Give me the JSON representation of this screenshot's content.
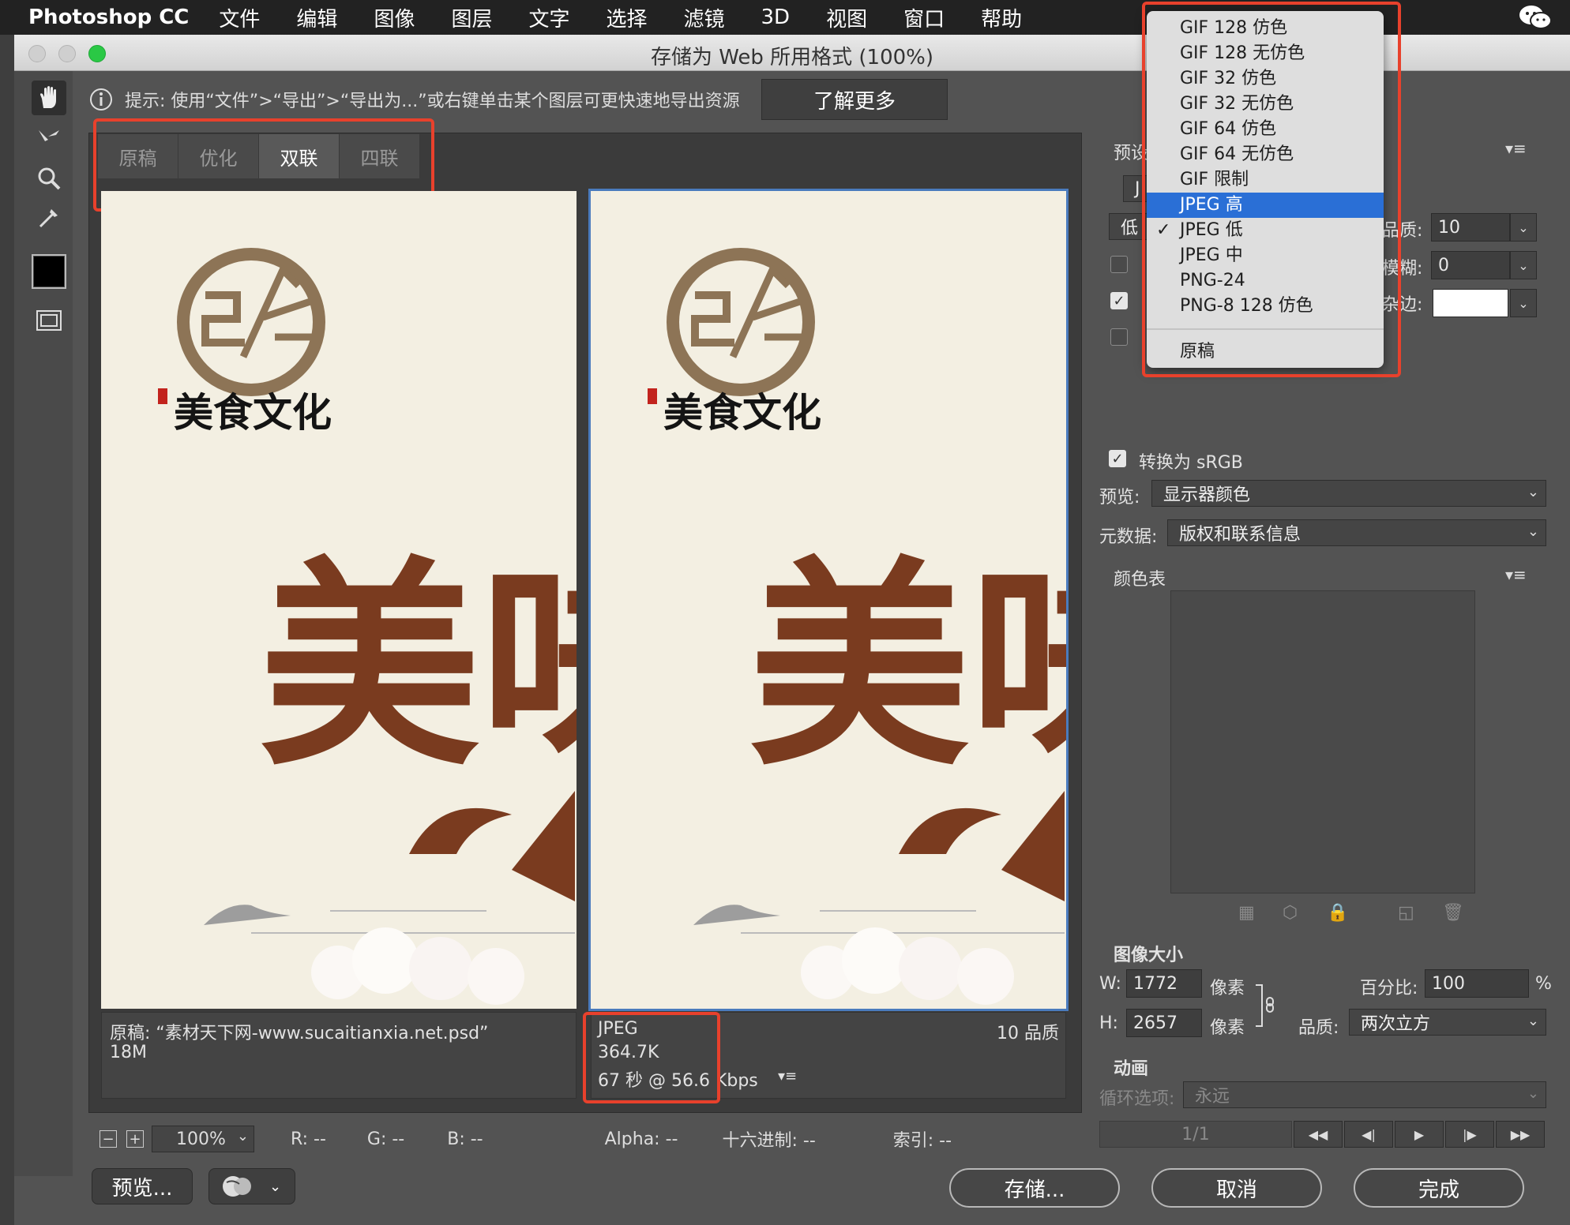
{
  "menubar": {
    "app_name": "Photoshop CC",
    "items": [
      "文件",
      "编辑",
      "图像",
      "图层",
      "文字",
      "选择",
      "滤镜",
      "3D",
      "视图",
      "窗口",
      "帮助"
    ]
  },
  "window": {
    "title": "存储为 Web 所用格式 (100%)"
  },
  "hint": {
    "text": "提示: 使用“文件”>“导出”>“导出为...”或右键单击某个图层可更快速地导出资源",
    "learn_more": "了解更多"
  },
  "tabs": [
    {
      "label": "原稿",
      "active": false
    },
    {
      "label": "优化",
      "active": false
    },
    {
      "label": "双联",
      "active": true
    },
    {
      "label": "四联",
      "active": false
    }
  ],
  "artwork": {
    "brand": "美食文化",
    "headline": "美味"
  },
  "left_pane": {
    "line1": "原稿: “素材天下网-www.sucaitianxia.net.psd”",
    "line2": "18M"
  },
  "right_pane": {
    "format": "JPEG",
    "size": "364.7K",
    "time": "67 秒 @ 56.6 Kbps",
    "quality": "10 品质"
  },
  "statusbar": {
    "zoom": "100%",
    "r": "R: --",
    "g": "G: --",
    "b": "B: --",
    "alpha": "Alpha: --",
    "hex": "十六进制: --",
    "index": "索引: --"
  },
  "buttons": {
    "preview": "预览...",
    "save": "存储...",
    "cancel": "取消",
    "done": "完成"
  },
  "preset_dropdown": {
    "options": [
      "GIF 128 仿色",
      "GIF 128 无仿色",
      "GIF 32 仿色",
      "GIF 32 无仿色",
      "GIF 64 仿色",
      "GIF 64 无仿色",
      "GIF 限制",
      "JPEG 高",
      "JPEG 低",
      "JPEG 中",
      "PNG-24",
      "PNG-8 128 仿色"
    ],
    "highlighted": "JPEG 高",
    "checked": "JPEG 低",
    "extra_option": "原稿"
  },
  "settings": {
    "preset_label_partial": "预设",
    "format_partial": "J",
    "quality_level_partial": "低",
    "quality_label": "品质:",
    "quality_value": "10",
    "blur_label": "模糊:",
    "blur_value": "0",
    "matte_label": "杂边:",
    "matte_color": "#ffffff",
    "checkbox_partial": "✓",
    "convert_srgb_checked": true,
    "convert_srgb_label": "转换为 sRGB",
    "preview_label": "预览:",
    "preview_value": "显示器颜色",
    "metadata_label": "元数据:",
    "metadata_value": "版权和联系信息",
    "color_table_label": "颜色表"
  },
  "image_size": {
    "title": "图像大小",
    "w_label": "W:",
    "w_value": "1772",
    "h_label": "H:",
    "h_value": "2657",
    "unit": "像素",
    "percent_label": "百分比:",
    "percent_value": "100",
    "percent_sign": "%",
    "quality_label": "品质:",
    "quality_value": "两次立方"
  },
  "animation": {
    "title": "动画",
    "loop_label": "循环选项:",
    "loop_value": "永远",
    "frame_counter": "1/1"
  },
  "colors": {
    "highlight_box": "#e8412c",
    "menu_selection": "#2a6fd6",
    "brush_brown": "#7a3b1f",
    "logo_brown": "#8d7456"
  }
}
